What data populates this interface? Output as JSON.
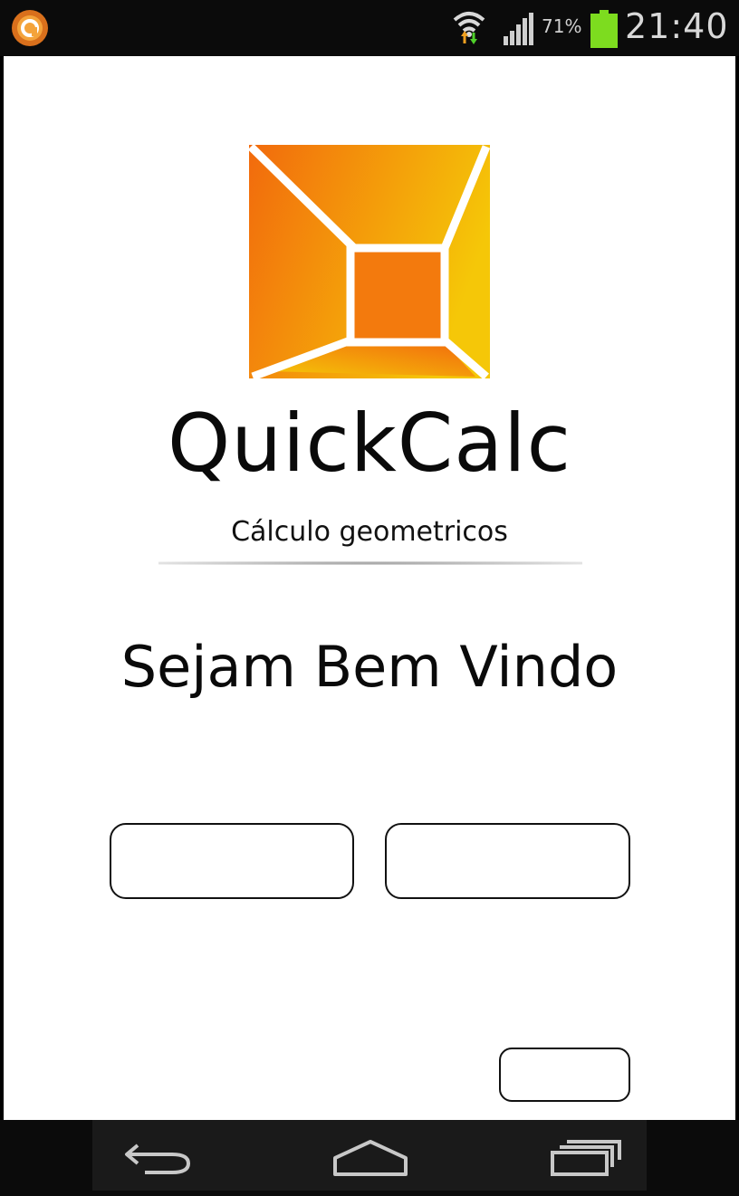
{
  "status_bar": {
    "icons": [
      "app-notification-icon",
      "wifi-icon",
      "signal-icon",
      "battery-icon"
    ],
    "battery_percent": "71%",
    "time": "21:40",
    "battery_color": "#7ddc1f",
    "notification_color": "#e07a1f"
  },
  "header": {
    "logo_icon": "quickcalc-logo-icon",
    "title": "QuickCalc",
    "subtitle": "Cálculo geometricos"
  },
  "main": {
    "welcome": "Sejam Bem Vindo",
    "buttons": [
      {
        "name": "left-button",
        "label": ""
      },
      {
        "name": "right-button",
        "label": ""
      },
      {
        "name": "small-button",
        "label": ""
      }
    ]
  },
  "nav_bar": {
    "items": [
      "back-icon",
      "home-icon",
      "recent-apps-icon"
    ]
  },
  "colors": {
    "logo_gradient_start": "#f26a0d",
    "logo_gradient_end": "#f5c708",
    "text": "#0a0a0a",
    "bars": "#0b0b0b"
  }
}
